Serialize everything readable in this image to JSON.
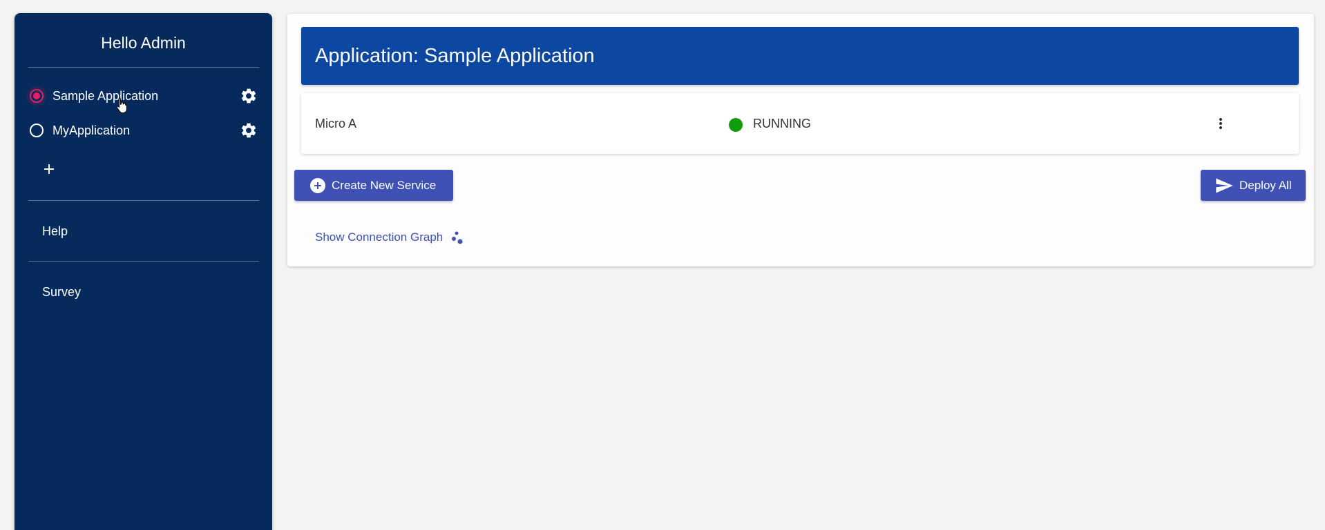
{
  "sidebar": {
    "greeting": "Hello Admin",
    "applications": [
      {
        "label": "Sample Application",
        "selected": true,
        "icon": "gear-icon"
      },
      {
        "label": "MyApplication",
        "selected": false,
        "icon": "gear-icon"
      }
    ],
    "add_icon": "plus-icon",
    "links": [
      {
        "label": "Help"
      },
      {
        "label": "Survey"
      }
    ],
    "colors": {
      "background": "#052a5b",
      "radio_selected": "#e91e63"
    }
  },
  "main": {
    "header_title": "Application: Sample Application",
    "services": [
      {
        "name": "Micro A",
        "status": "RUNNING",
        "status_color": "#119c0d",
        "menu_icon": "more-vert-icon"
      }
    ],
    "create_button": {
      "label": "Create New Service",
      "icon": "add-circle-icon"
    },
    "deploy_button": {
      "label": "Deploy All",
      "icon": "send-icon"
    },
    "graph_link": {
      "label": "Show Connection Graph",
      "icon": "bubble-chart-icon"
    },
    "colors": {
      "header": "#0c47a1",
      "primary": "#3f51b5"
    }
  }
}
